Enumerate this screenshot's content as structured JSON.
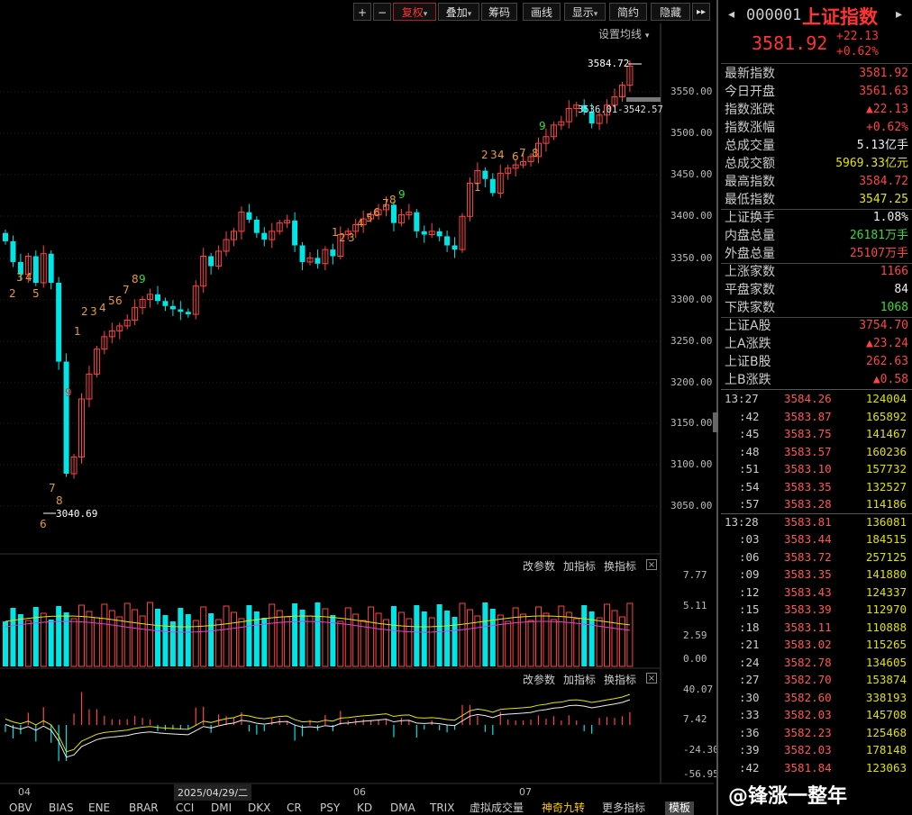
{
  "toolbar": {
    "plus": "+",
    "minus": "−",
    "fuquan": "复权",
    "diejia": "叠加",
    "chouma": "筹码",
    "huaxian": "画线",
    "xianshi": "显示",
    "jianyue": "简约",
    "yincang": "隐藏",
    "arrow_more": "▸▸",
    "dropdown": "▾"
  },
  "main_chart": {
    "ma_setting": "设置均线",
    "high_label": "3584.72",
    "low_label": "3040.69",
    "range_label": "3536.01-3542.57",
    "price_axis": [
      "3550.00",
      "3500.00",
      "3450.00",
      "3400.00",
      "3350.00",
      "3300.00",
      "3250.00",
      "3200.00",
      "3150.00",
      "3100.00",
      "3050.00"
    ]
  },
  "indicator1": {
    "gaicanshu": "改参数",
    "jiazhibiao": "加指标",
    "huanzhibiao": "换指标",
    "close": "×",
    "axis": [
      "7.77",
      "5.11",
      "2.59",
      "0.00"
    ]
  },
  "indicator2": {
    "gaicanshu": "改参数",
    "jiazhibiao": "加指标",
    "huanzhibiao": "换指标",
    "close": "×",
    "axis": [
      "40.07",
      "7.42",
      "-24.30",
      "-56.95"
    ]
  },
  "x_axis": {
    "m04": "04",
    "date": "2025/04/29/二",
    "m06": "06",
    "m07": "07"
  },
  "bottom_tabs": [
    "OBV",
    "BIAS",
    "ENE",
    "BRAR",
    "CCI",
    "DMI",
    "DKX",
    "CR",
    "PSY",
    "KD",
    "DMA",
    "TRIX",
    "虚拟成交量",
    "神奇九转",
    "更多指标",
    "模板"
  ],
  "watermark": "@锋涨一整年",
  "colors": {
    "up": "#ff4444",
    "down": "#00e5e5",
    "ma": "#e6e600",
    "accent": "#ff3333"
  },
  "quote": {
    "code": "000001",
    "name": "上证指数",
    "price": "3581.92",
    "change": "+22.13",
    "pct": "+0.62%",
    "rows": [
      {
        "k": "最新指数",
        "v": "3581.92",
        "c": "red"
      },
      {
        "k": "今日开盘",
        "v": "3561.63",
        "c": "red"
      },
      {
        "k": "指数涨跌",
        "v": "▲22.13",
        "c": "red"
      },
      {
        "k": "指数涨幅",
        "v": "+0.62%",
        "c": "red"
      },
      {
        "k": "总成交量",
        "v": "5.13亿手",
        "c": "white"
      },
      {
        "k": "总成交额",
        "v": "5969.33亿元",
        "c": "yellow"
      },
      {
        "k": "最高指数",
        "v": "3584.72",
        "c": "red"
      },
      {
        "k": "最低指数",
        "v": "3547.25",
        "c": "yellow"
      },
      {
        "k": "上证换手",
        "v": "1.08%",
        "c": "white"
      },
      {
        "k": "内盘总量",
        "v": "26181万手",
        "c": "green"
      },
      {
        "k": "外盘总量",
        "v": "25107万手",
        "c": "red"
      },
      {
        "k": "上涨家数",
        "v": "1166",
        "c": "red"
      },
      {
        "k": "平盘家数",
        "v": "84",
        "c": "white"
      },
      {
        "k": "下跌家数",
        "v": "1068",
        "c": "green"
      },
      {
        "k": "上证A股",
        "v": "3754.70",
        "c": "red"
      },
      {
        "k": "上A涨跌",
        "v": "▲23.24",
        "c": "red"
      },
      {
        "k": "上证B股",
        "v": "262.63",
        "c": "red"
      },
      {
        "k": "上B涨跌",
        "v": "▲0.58",
        "c": "red"
      }
    ],
    "ticks": [
      {
        "t": "13:27",
        "p": "3584.26",
        "v": "124004"
      },
      {
        "t": ":42",
        "p": "3583.87",
        "v": "165892"
      },
      {
        "t": ":45",
        "p": "3583.75",
        "v": "141467"
      },
      {
        "t": ":48",
        "p": "3583.57",
        "v": "160236"
      },
      {
        "t": ":51",
        "p": "3583.10",
        "v": "157732"
      },
      {
        "t": ":54",
        "p": "3583.35",
        "v": "132527"
      },
      {
        "t": ":57",
        "p": "3583.28",
        "v": "114186"
      },
      {
        "t": "13:28",
        "p": "3583.81",
        "v": "136081"
      },
      {
        "t": ":03",
        "p": "3583.44",
        "v": "184515"
      },
      {
        "t": ":06",
        "p": "3583.72",
        "v": "257125"
      },
      {
        "t": ":09",
        "p": "3583.35",
        "v": "141880"
      },
      {
        "t": ":12",
        "p": "3583.43",
        "v": "124337"
      },
      {
        "t": ":15",
        "p": "3583.39",
        "v": "112970"
      },
      {
        "t": ":18",
        "p": "3583.11",
        "v": "110888"
      },
      {
        "t": ":21",
        "p": "3583.02",
        "v": "115265"
      },
      {
        "t": ":24",
        "p": "3582.78",
        "v": "134605"
      },
      {
        "t": ":27",
        "p": "3582.70",
        "v": "153874"
      },
      {
        "t": ":30",
        "p": "3582.60",
        "v": "338193"
      },
      {
        "t": ":33",
        "p": "3582.03",
        "v": "145708"
      },
      {
        "t": ":36",
        "p": "3582.23",
        "v": "125468"
      },
      {
        "t": ":39",
        "p": "3582.03",
        "v": "178148"
      },
      {
        "t": ":42",
        "p": "3581.84",
        "v": "123063"
      }
    ]
  }
}
